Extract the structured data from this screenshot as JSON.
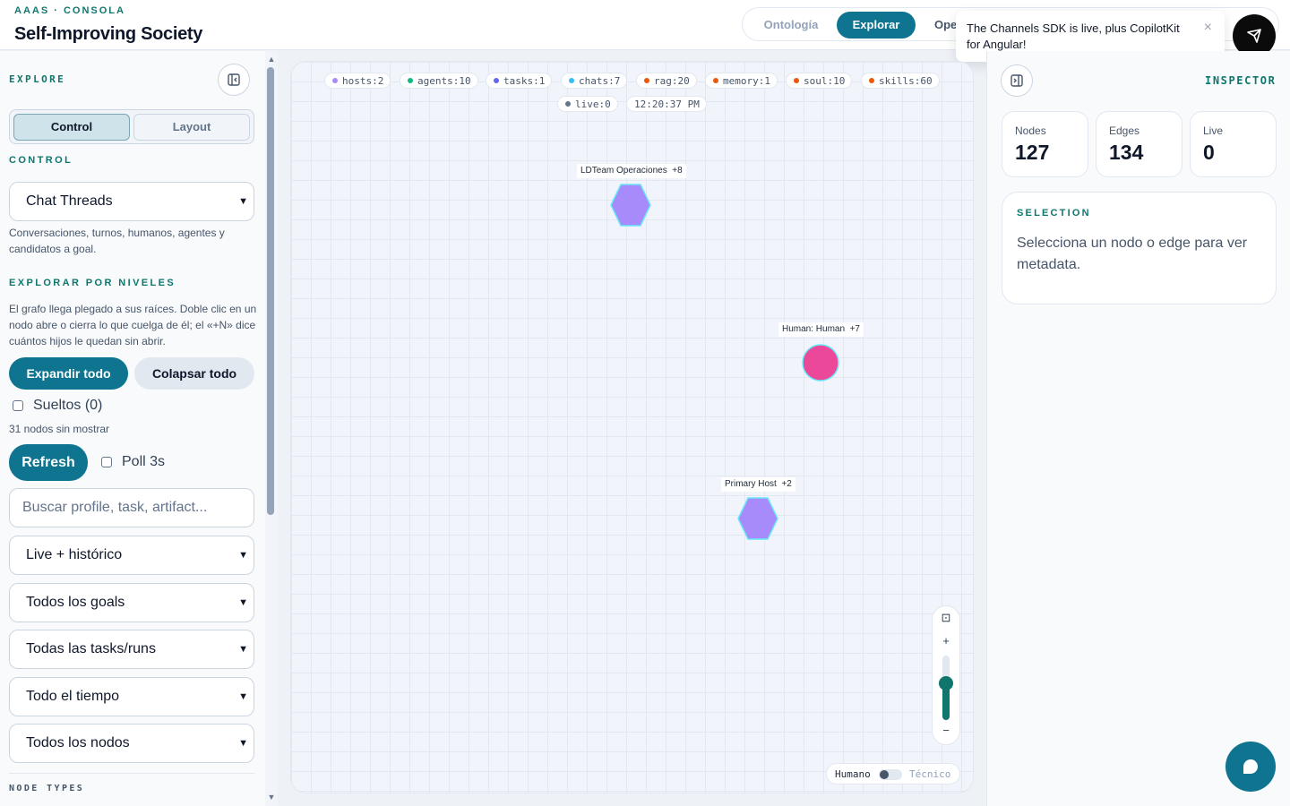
{
  "header": {
    "kicker": "AAAS · CONSOLA",
    "title": "Self-Improving Society",
    "tabs": [
      {
        "label": "Ontología"
      },
      {
        "label": "Explorar"
      },
      {
        "label": "Ope"
      }
    ]
  },
  "toast": {
    "message": "The Channels SDK is live, plus CopilotKit for Angular!",
    "close": "×"
  },
  "left": {
    "explore_label": "EXPLORE",
    "segments": [
      "Control",
      "Layout"
    ],
    "control_label": "CONTROL",
    "view_select": "Chat Threads",
    "view_help": "Conversaciones, turnos, humanos, agentes y candidatos a goal.",
    "levels_label": "EXPLORAR POR NIVELES",
    "levels_help": "El grafo llega plegado a sus raíces. Doble clic en un nodo abre o cierra lo que cuelga de él; el «+N» dice cuántos hijos le quedan sin abrir.",
    "expand_all": "Expandir todo",
    "collapse_all": "Colapsar todo",
    "loose_label": "Sueltos (0)",
    "hidden_count": "31 nodos sin mostrar",
    "refresh": "Refresh",
    "poll_label": "Poll 3s",
    "search_placeholder": "Buscar profile, task, artifact...",
    "filters": [
      "Live + histórico",
      "Todos los goals",
      "Todas las tasks/runs",
      "Todo el tiempo",
      "Todos los nodos"
    ],
    "node_types_label": "NODE TYPES"
  },
  "canvas": {
    "chips": [
      {
        "label": "hosts:2",
        "color": "#a78bfa"
      },
      {
        "label": "agents:10",
        "color": "#10b981"
      },
      {
        "label": "tasks:1",
        "color": "#6366f1"
      },
      {
        "label": "chats:7",
        "color": "#38bdf8"
      },
      {
        "label": "rag:20",
        "color": "#ea580c"
      },
      {
        "label": "memory:1",
        "color": "#ea580c"
      },
      {
        "label": "soul:10",
        "color": "#ea580c"
      },
      {
        "label": "skills:60",
        "color": "#ea580c"
      },
      {
        "label": "live:0",
        "color": "#64748b"
      },
      {
        "label": "12:20:37 PM",
        "color": ""
      }
    ],
    "nodes": [
      {
        "label": "LDTeam Operaciones",
        "more": "+8",
        "shape": "hexagon",
        "color": "#a78bfa"
      },
      {
        "label": "Human: Human",
        "more": "+7",
        "shape": "circle",
        "color": "#ec4899"
      },
      {
        "label": "Primary Host",
        "more": "+2",
        "shape": "hexagon",
        "color": "#a78bfa"
      }
    ],
    "zoom": {
      "fit": "⊡",
      "plus": "+",
      "minus": "−",
      "level": 0.55
    },
    "toggle": {
      "left": "Humano",
      "right": "Técnico"
    }
  },
  "inspector": {
    "label": "INSPECTOR",
    "stats": [
      {
        "key": "Nodes",
        "value": "127"
      },
      {
        "key": "Edges",
        "value": "134"
      },
      {
        "key": "Live",
        "value": "0"
      }
    ],
    "selection_label": "SELECTION",
    "selection_text": "Selecciona un nodo o edge para ver metadata."
  },
  "colors": {
    "accent": "#0e7490",
    "brand": "#0f766e"
  }
}
